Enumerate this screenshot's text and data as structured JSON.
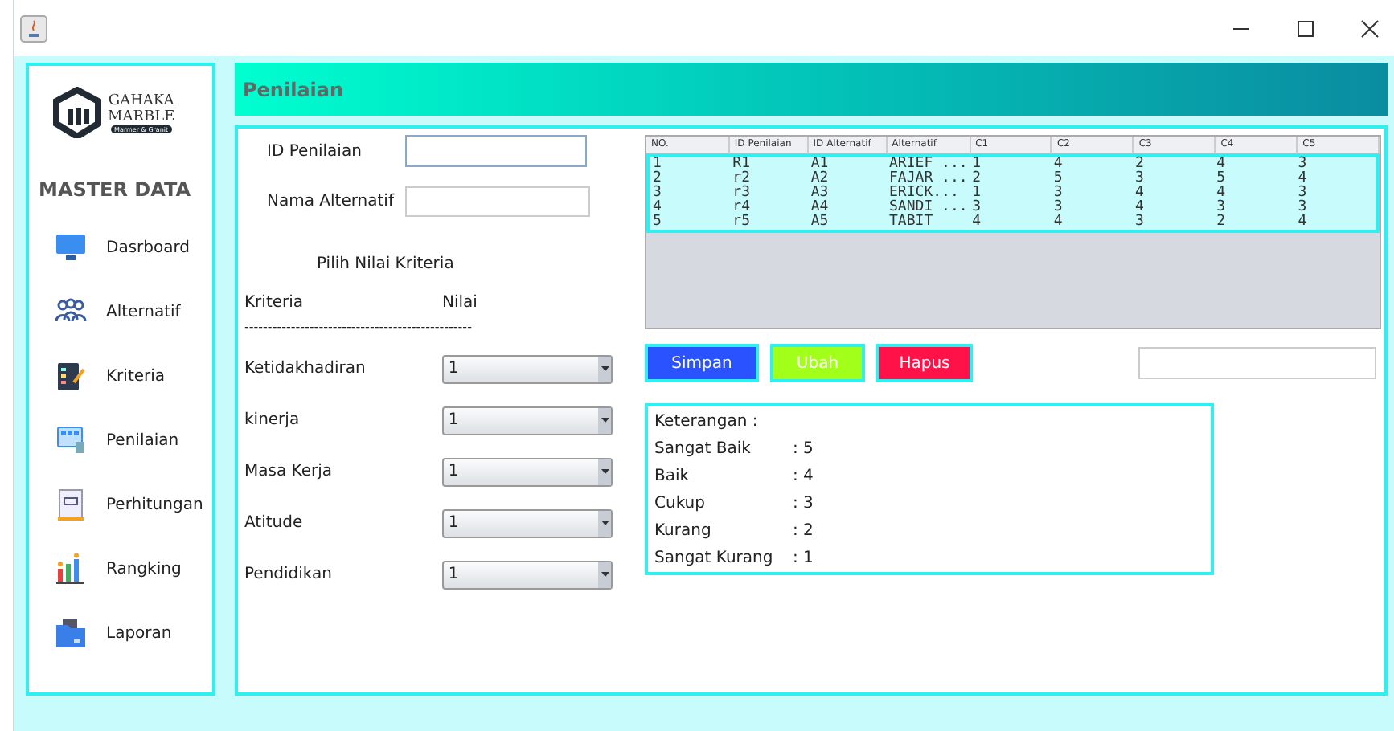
{
  "logo": {
    "name_top": "GAHAKA",
    "name_bottom": "MARBLE",
    "tagline": "Marmer & Granit"
  },
  "sidebar": {
    "heading": "MASTER DATA",
    "items": [
      {
        "label": "Dasrboard",
        "kind": "monitor"
      },
      {
        "label": "Alternatif",
        "kind": "people"
      },
      {
        "label": "Kriteria",
        "kind": "clipboard"
      },
      {
        "label": "Penilaian",
        "kind": "screen"
      },
      {
        "label": "Perhitungan",
        "kind": "document"
      },
      {
        "label": "Rangking",
        "kind": "chart"
      },
      {
        "label": "Laporan",
        "kind": "folder"
      }
    ]
  },
  "header": {
    "title": "Penilaian"
  },
  "form": {
    "id_label": "ID Penilaian",
    "name_label": "Nama Alternatif",
    "section_title": "Pilih Nilai Kriteria",
    "col_criteria": "Kriteria",
    "col_value": "Nilai",
    "divider": "-------------------------------------------------",
    "criteria": [
      {
        "label": "Ketidakhadiran",
        "value": "1"
      },
      {
        "label": "kinerja",
        "value": "1"
      },
      {
        "label": "Masa Kerja",
        "value": "1"
      },
      {
        "label": "Atitude",
        "value": "1"
      },
      {
        "label": "Pendidikan",
        "value": "1"
      }
    ]
  },
  "table": {
    "columns": [
      "NO.",
      "ID Penilaian",
      "ID Alternatif",
      "Alternatif",
      "C1",
      "C2",
      "C3",
      "C4",
      "C5"
    ],
    "rows": [
      {
        "cells": [
          "1",
          "R1",
          "A1",
          "ARIEF ...",
          "1",
          "4",
          "2",
          "4",
          "3"
        ],
        "selected": true
      },
      {
        "cells": [
          "2",
          "r2",
          "A2",
          "FAJAR ...",
          "2",
          "5",
          "3",
          "5",
          "4"
        ],
        "selected": true
      },
      {
        "cells": [
          "3",
          "r3",
          "A3",
          "ERICK...",
          "1",
          "3",
          "4",
          "4",
          "3"
        ],
        "selected": true
      },
      {
        "cells": [
          "4",
          "r4",
          "A4",
          "SANDI ...",
          "3",
          "3",
          "4",
          "3",
          "3"
        ],
        "selected": true
      },
      {
        "cells": [
          "5",
          "r5",
          "A5",
          "TABIT",
          "4",
          "4",
          "3",
          "2",
          "4"
        ],
        "selected": true
      }
    ]
  },
  "buttons": [
    {
      "label": "Simpan",
      "color": "#2a52ff"
    },
    {
      "label": "Ubah",
      "color": "#a2ff1a"
    },
    {
      "label": "Hapus",
      "color": "#ff1248"
    }
  ],
  "legend": {
    "title": "Keterangan :",
    "entries": [
      {
        "term": "Sangat Baik",
        "value": ": 5"
      },
      {
        "term": "Baik",
        "value": ": 4"
      },
      {
        "term": "Cukup",
        "value": ": 3"
      },
      {
        "term": "Kurang",
        "value": ": 2"
      },
      {
        "term": "Sangat Kurang",
        "value": ": 1"
      }
    ]
  }
}
